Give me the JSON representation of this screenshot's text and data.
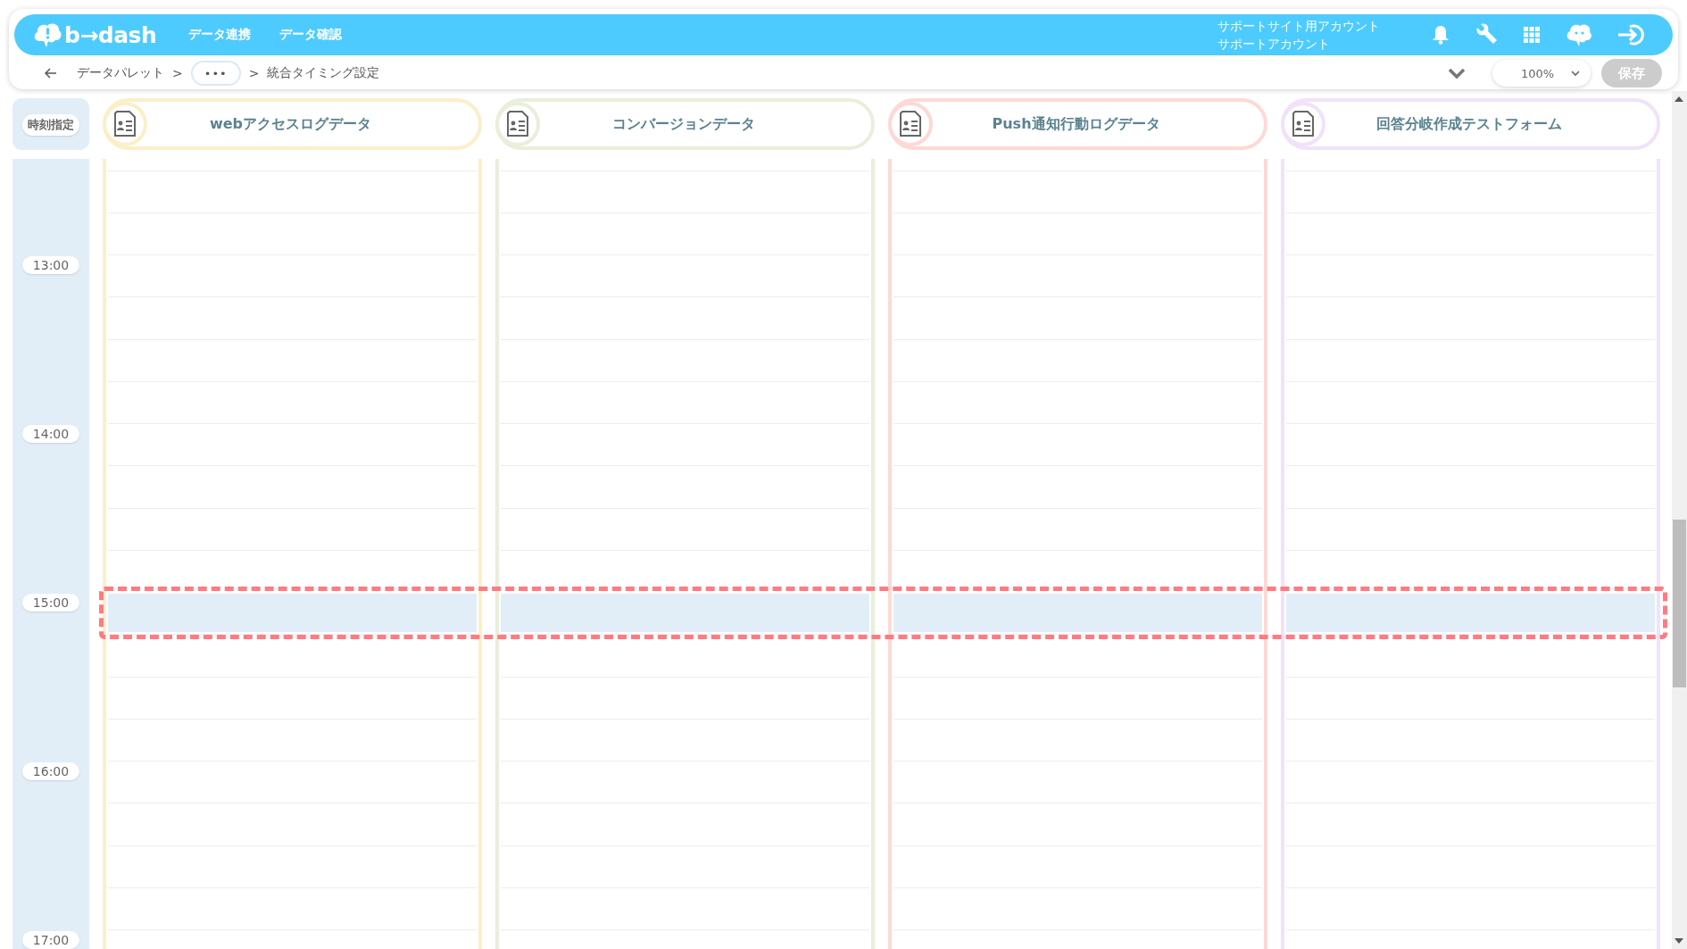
{
  "header": {
    "logo": "b→dash",
    "nav": [
      {
        "label": "データ連携"
      },
      {
        "label": "データ確認"
      }
    ],
    "account": {
      "site": "サポートサイト用アカウント",
      "user": "サポートアカウント"
    }
  },
  "breadcrumb": [
    {
      "kind": "link",
      "label": "データパレット"
    },
    {
      "kind": "separator",
      "label": ">"
    },
    {
      "kind": "ellipsis",
      "label": "•••"
    },
    {
      "kind": "separator",
      "label": ">"
    },
    {
      "kind": "current",
      "label": "統合タイミング設定"
    }
  ],
  "zoom": {
    "value": "100%"
  },
  "save_button": {
    "label": "保存",
    "disabled": true
  },
  "time_header": "時刻指定",
  "columns": [
    {
      "name": "webアクセスログデータ",
      "color": "#fcefc8"
    },
    {
      "name": "コンバージョンデータ",
      "color": "#e9efda"
    },
    {
      "name": "Push通知行動ログデータ",
      "color": "#fdd9d6"
    },
    {
      "name": "回答分岐作成テストフォーム",
      "color": "#f2e1fb"
    }
  ],
  "hours": [
    {
      "slots": [
        {
          "selected": false
        },
        {
          "selected": false
        },
        {
          "selected": false
        }
      ]
    },
    {
      "label": "13:00",
      "slots": [
        {
          "selected": false
        },
        {
          "selected": false
        },
        {
          "selected": false
        },
        {
          "selected": false
        }
      ]
    },
    {
      "label": "14:00",
      "slots": [
        {
          "selected": false
        },
        {
          "selected": false
        },
        {
          "selected": false
        },
        {
          "selected": false
        }
      ]
    },
    {
      "label": "15:00",
      "slots": [
        {
          "selected": true
        },
        {
          "selected": false
        },
        {
          "selected": false
        },
        {
          "selected": false
        }
      ]
    },
    {
      "label": "16:00",
      "slots": [
        {
          "selected": false
        },
        {
          "selected": false
        },
        {
          "selected": false
        },
        {
          "selected": false
        }
      ]
    },
    {
      "label": "17:00",
      "slots": [
        {
          "selected": false
        }
      ]
    }
  ]
}
